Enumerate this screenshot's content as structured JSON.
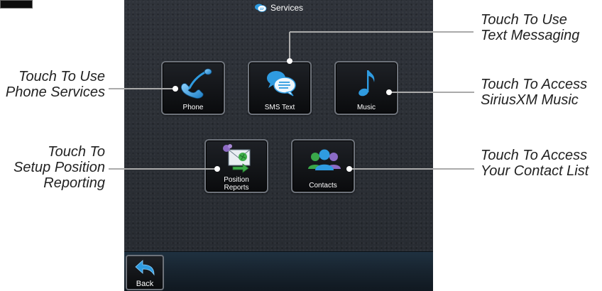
{
  "screen": {
    "title": "Services",
    "buttons": {
      "phone": "Phone",
      "sms": "SMS Text",
      "music": "Music",
      "position_line1": "Position",
      "position_line2": "Reports",
      "contacts": "Contacts"
    },
    "back_label": "Back"
  },
  "callouts": {
    "text_messaging": [
      "Touch To Use",
      "Text Messaging"
    ],
    "phone_services": [
      "Touch To Use",
      "Phone Services"
    ],
    "siriusxm_music": [
      "Touch To Access",
      "SiriusXM Music"
    ],
    "position_reporting": [
      "Touch To",
      "Setup Position",
      "Reporting"
    ],
    "contact_list": [
      "Touch To Access",
      "Your Contact List"
    ]
  },
  "colors": {
    "accent_blue": "#2f9be0",
    "button_border": "#6d727a",
    "leader_line": "#aaaaaa"
  },
  "icons": {
    "title": "chat-bubbles-icon",
    "phone": "telephone-handset-icon",
    "sms": "speech-bubbles-icon",
    "music": "music-note-icon",
    "position": "envelope-arrow-icon",
    "contacts": "people-group-icon",
    "back": "back-arrow-icon"
  }
}
